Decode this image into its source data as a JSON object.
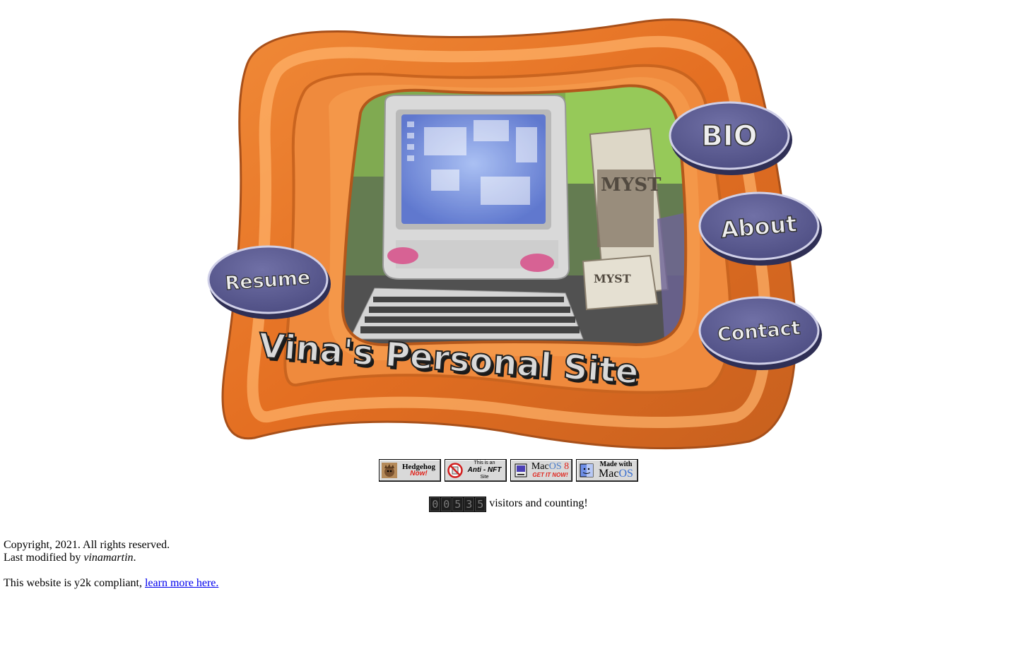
{
  "hero": {
    "title": "Vina's Personal Site",
    "nav": {
      "bio": "BIO",
      "about": "About",
      "contact": "Contact",
      "resume": "Resume"
    },
    "photo_box_label": "MYST",
    "photo_box_label_2": "MYST"
  },
  "badges": [
    {
      "top": "Hedgehog",
      "bottom": "Now!",
      "icon": "hedgehog-icon"
    },
    {
      "line1": "This is an",
      "line2": "Anti - NFT",
      "line3": "Site",
      "icon": "no-nft-icon"
    },
    {
      "mac": "Mac",
      "os": "OS",
      "ver": "8",
      "bottom": "GET IT NOW!",
      "icon": "mac-computer-icon"
    },
    {
      "top": "Made with",
      "mac": "Mac",
      "os": "OS",
      "icon": "finder-face-icon"
    }
  ],
  "counter": {
    "digits": [
      "0",
      "0",
      "5",
      "3",
      "5"
    ],
    "text": " visitors and counting!"
  },
  "footer": {
    "copyright": "Copyright, 2021. All rights reserved.",
    "modified_prefix": "Last modified by ",
    "modified_user": "vinamartin",
    "modified_suffix": ".",
    "y2k_prefix": "This website is y2k compliant, ",
    "y2k_link": "learn more here."
  },
  "colors": {
    "frame_orange": "#e8782a",
    "frame_light": "#ffa552",
    "frame_dark": "#b8581c",
    "button_purple": "#5c5c92",
    "link_blue": "#0000ee"
  }
}
